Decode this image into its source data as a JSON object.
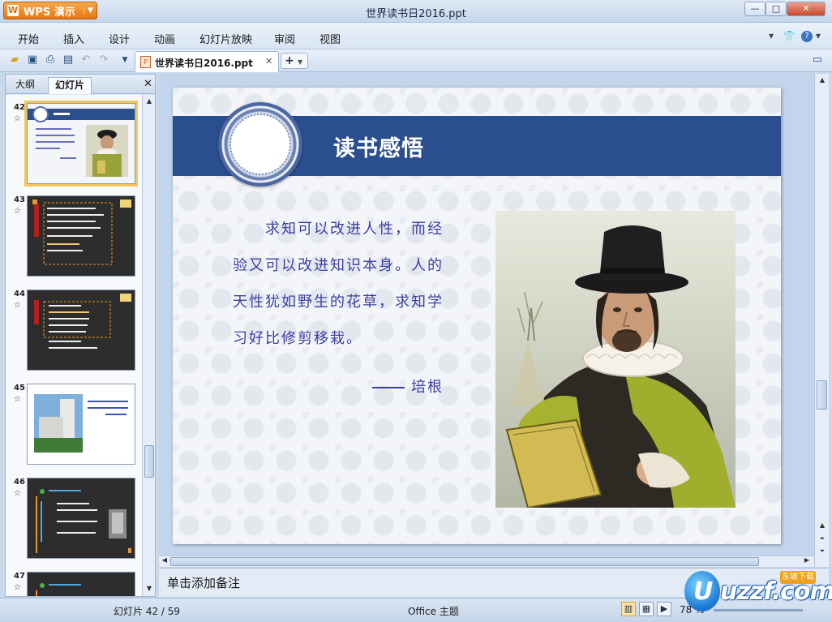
{
  "app": {
    "button_label": "WPS 演示",
    "window_title": "世界读书日2016.ppt"
  },
  "window_controls": {
    "minimize": "—",
    "maximize": "□",
    "close": "✕"
  },
  "menu": {
    "items": [
      "开始",
      "插入",
      "设计",
      "动画",
      "幻灯片放映",
      "审阅",
      "视图"
    ]
  },
  "document_tab": {
    "name": "世界读书日2016.ppt",
    "close": "✕"
  },
  "left_panel": {
    "tabs": [
      "大纲",
      "幻灯片"
    ],
    "active_tab": "幻灯片",
    "close": "✕",
    "slides": [
      {
        "number": "42",
        "selected": true
      },
      {
        "number": "43",
        "selected": false
      },
      {
        "number": "44",
        "selected": false
      },
      {
        "number": "45",
        "selected": false
      },
      {
        "number": "46",
        "selected": false
      },
      {
        "number": "47",
        "selected": false
      }
    ]
  },
  "slide": {
    "title": "读书感悟",
    "quote_lines": [
      "求知可以改进人性，而经",
      "验又可以改进知识本身。人的",
      "天性犹如野生的花草，求知学",
      "习好比修剪移栽。"
    ],
    "attribution": "培根"
  },
  "notes": {
    "placeholder": "单击添加备注"
  },
  "status": {
    "slide_label": "幻灯片 42 / 59",
    "theme": "Office 主题",
    "zoom": "78 %"
  },
  "watermark": {
    "text": "uzzf.com",
    "badge": "东坡下载"
  },
  "colors": {
    "title_band": "#2b4f8e",
    "quote_text": "#3a3fa0",
    "app_button": "#e67612",
    "selection": "#f1c75d"
  }
}
